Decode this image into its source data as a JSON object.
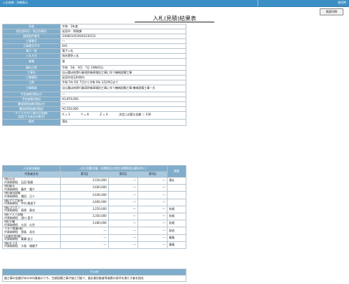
{
  "topbar": {
    "breadcrumb": "入札結果／詳細表示",
    "right_label": "使用時"
  },
  "print_button": "画面印刷",
  "page_title": "入札(見積)結果表",
  "info_rows": [
    {
      "label": "年度",
      "value": "令和　3年度"
    },
    {
      "label": "発注部局名／発注所属名",
      "value": "岩見市　財務課"
    },
    {
      "label": "調達案件番号",
      "value": "3306010520020230121"
    },
    {
      "label": "工事番号",
      "value": "---"
    },
    {
      "label": "工事番号手号",
      "value": "641"
    },
    {
      "label": "電子／紙",
      "value": "電子入札"
    },
    {
      "label": "入札方式",
      "value": "指名競争入札"
    },
    {
      "label": "業種",
      "value": "管"
    },
    {
      "label": "開札日時",
      "value": "令和　5年　9月　7日 10時45分"
    },
    {
      "label": "工事名",
      "value": "自元重ほ校第行鄙滴防衛車場旧工事に伴う機械設備工事"
    },
    {
      "label": "工事場所",
      "value": "岩見市花石町地内"
    },
    {
      "label": "工期",
      "value": "令和 5年 9月 7日から令和 6年 2月29日まで"
    },
    {
      "label": "工事概要",
      "value": "自元重ほ校第行鄙滴防衛車場旧工事に伴う機械設備工事 機械設備工事一式"
    },
    {
      "label": "予定価格(税抜き)",
      "value": "---"
    },
    {
      "label": "予定価格(税抜)",
      "value": "¥3,870,000-"
    },
    {
      "label": "最低制限価格(税抜き)",
      "value": "---"
    },
    {
      "label": "最低制限価格(税抜)",
      "value": "¥3,550,000-"
    },
    {
      "label": "ＸＹＺ方式(二重号の金額)\n(設定する該当の数字)",
      "value": "X = 3　　　　Y = 8　　　　Z = 4　　　　決定に必要な金額 ＝ 436"
    },
    {
      "label": "備考",
      "value": "落札"
    }
  ],
  "bid_table": {
    "headers": {
      "bidder": "入札参加業者",
      "company": "代表者氏名",
      "amounts": "入札(見積)金額（消費税及び地方消費税相当額を除く）",
      "round1": "第1回",
      "round2": "第2回",
      "round3": "第3回",
      "remarks": "摘要"
    },
    "rows": [
      {
        "name": "(株)石田\n代表取締役　石田 智康",
        "r1": "3,550,000",
        "r2": "---",
        "r3": "---",
        "remark": "落札"
      },
      {
        "name": "(株)龍水\n代表取締役　藤井　隆介",
        "r1": "3,600,000",
        "r2": "---",
        "r3": "---",
        "remark": ""
      },
      {
        "name": "(株)蒲田設備\n代表取締役　蒲田　正人",
        "r1": "3,640,000",
        "r2": "---",
        "r3": "---",
        "remark": ""
      },
      {
        "name": "(株)アクア東海\n代表取締役　中村 美波子",
        "r1": "3,660,000",
        "r2": "---",
        "r3": "---",
        "remark": ""
      },
      {
        "name": "(株)コウケン\n代表取締役　高原　真也",
        "r1": "3,250,000",
        "r2": "---",
        "r3": "---",
        "remark": "失格"
      },
      {
        "name": "(株)イズミ設備\n代表取締役　濱口 直子",
        "r1": "3,350,000",
        "r2": "---",
        "r3": "---",
        "remark": "失格"
      },
      {
        "name": "(株)大輔\n代表取締役　久田　久世",
        "r1": "3,480,000",
        "r2": "---",
        "r3": "---",
        "remark": "失格"
      },
      {
        "name": "フタバ商業(株)\n代表取締役　窪島　浩光",
        "r1": "---",
        "r2": "---",
        "r3": "---",
        "remark": "辞退"
      },
      {
        "name": "(山陽住宅(株)\n代表取締役　葉藤 益士",
        "r1": "---",
        "r2": "---",
        "r3": "---",
        "remark": "棄権"
      },
      {
        "name": "(株)モイス\n代表取締役　大島　雄健子",
        "r1": "---",
        "r2": "---",
        "r3": "---",
        "remark": "棄権"
      }
    ]
  },
  "other": {
    "header": "その他",
    "text": "施工事の金額が本の市内業者のうち、空調設備工事が施工可能で、能計業別能者等者数の条件を満たす者を指名"
  }
}
